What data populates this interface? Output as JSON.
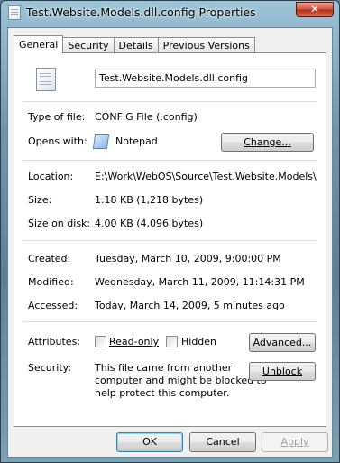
{
  "window": {
    "title": "Test.Website.Models.dll.config Properties",
    "close_glyph": "✕"
  },
  "tabs": [
    {
      "label": "General",
      "active": true
    },
    {
      "label": "Security",
      "active": false
    },
    {
      "label": "Details",
      "active": false
    },
    {
      "label": "Previous Versions",
      "active": false
    }
  ],
  "general": {
    "file_name": "Test.Website.Models.dll.config",
    "type_label": "Type of file:",
    "type_value": "CONFIG File (.config)",
    "opens_label": "Opens with:",
    "opens_value": "Notepad",
    "change_label": "Change...",
    "location_label": "Location:",
    "location_value": "E:\\Work\\WebOS\\Source\\Test.Website.Models\\bin",
    "size_label": "Size:",
    "size_value": "1.18 KB (1,218 bytes)",
    "size_on_disk_label": "Size on disk:",
    "size_on_disk_value": "4.00 KB (4,096 bytes)",
    "created_label": "Created:",
    "created_value": "Tuesday, March 10, 2009, 9:00:00 PM",
    "modified_label": "Modified:",
    "modified_value": "Wednesday, March 11, 2009, 11:14:31 PM",
    "accessed_label": "Accessed:",
    "accessed_value": "Today, March 14, 2009, 5 minutes ago",
    "attributes_label": "Attributes:",
    "readonly_label": "Read-only",
    "hidden_label": "Hidden",
    "advanced_label": "Advanced...",
    "security_label": "Security:",
    "security_line1": "This file came from another",
    "security_line2": "computer and might be blocked to",
    "security_line3": "help protect this computer.",
    "unblock_label": "Unblock"
  },
  "footer": {
    "ok_label": "OK",
    "cancel_label": "Cancel",
    "apply_label": "Apply"
  }
}
